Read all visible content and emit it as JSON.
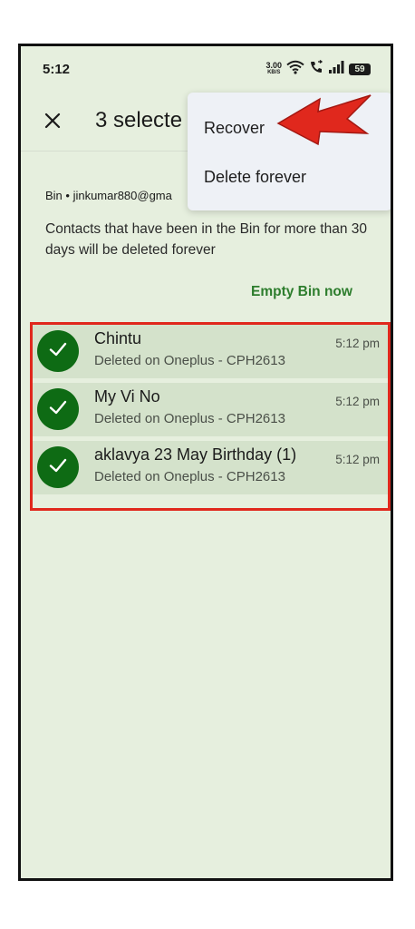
{
  "status_bar": {
    "time": "5:12",
    "net_speed_value": "3.00",
    "net_speed_unit": "KB/S",
    "battery": "59",
    "icons": [
      "wifi-icon",
      "volte-call-icon",
      "signal-icon",
      "battery-icon"
    ]
  },
  "app_bar": {
    "close_icon": "close-icon",
    "title": "3 selecte"
  },
  "menu": {
    "items": [
      {
        "label": "Recover"
      },
      {
        "label": "Delete forever"
      }
    ]
  },
  "bin": {
    "account": "Bin • jinkumar880@gma",
    "note": "Contacts that have been in the Bin for more than 30 days will be deleted forever",
    "empty_button": "Empty Bin now"
  },
  "contacts": [
    {
      "name": "Chintu",
      "deleted_on": "Deleted on Oneplus - CPH2613",
      "time": "5:12 pm",
      "selected": true
    },
    {
      "name": "My Vi No",
      "deleted_on": "Deleted on Oneplus - CPH2613",
      "time": "5:12 pm",
      "selected": true
    },
    {
      "name": "aklavya 23 May Birthday (1)",
      "deleted_on": "Deleted on Oneplus - CPH2613",
      "time": "5:12 pm",
      "selected": true
    }
  ],
  "colors": {
    "background": "#e6efde",
    "selected_row": "#d4e2cb",
    "check_green": "#0e6b14",
    "accent_green": "#2d7d2d",
    "annotation_red": "#e0281d",
    "menu_bg": "#eef1f6"
  }
}
